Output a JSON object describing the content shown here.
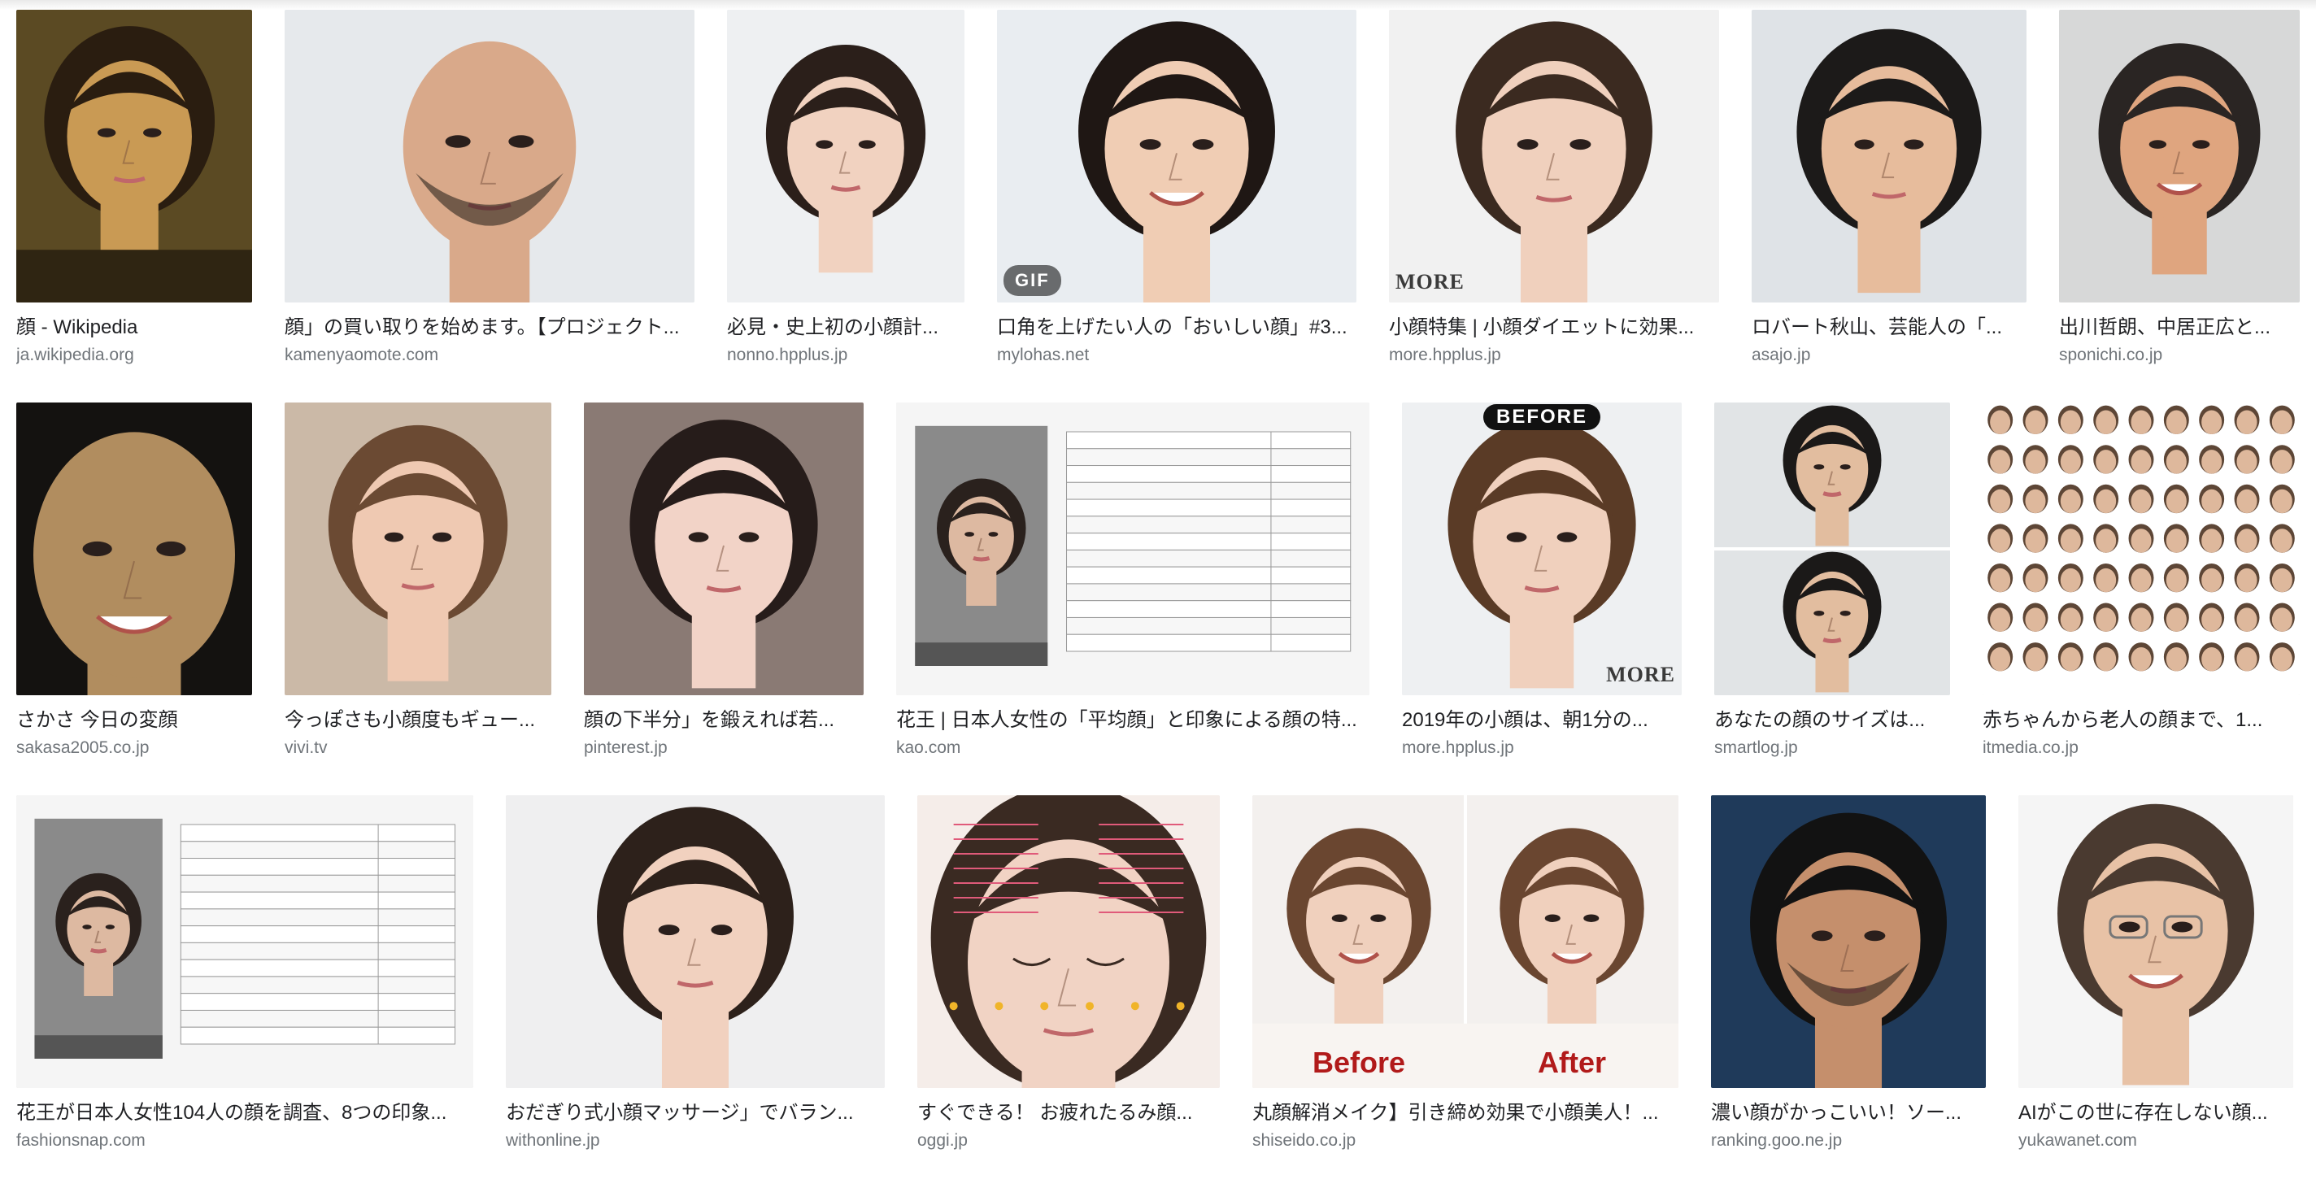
{
  "results": [
    [
      {
        "caption": "顔 - Wikipedia",
        "domain": "ja.wikipedia.org",
        "image": "mona-lisa-painting",
        "bg": "#5b4a23",
        "skin": "#c99a54",
        "hair": "#2a1d10"
      },
      {
        "caption": "顔」の買い取りを始めます。【プロジェクト...",
        "domain": "kamenyaomote.com",
        "image": "realistic-face-mask",
        "bg": "#e6e9ec",
        "skin": "#d9a98a",
        "hair": "#e6e9ec"
      },
      {
        "caption": "必見・史上初の小顔計...",
        "domain": "nonno.hpplus.jp",
        "image": "woman-portrait",
        "bg": "#eef0f2",
        "skin": "#f1d2c0",
        "hair": "#2b1f1a"
      },
      {
        "caption": "口角を上げたい人の「おいしい顔」#3...",
        "domain": "mylohas.net",
        "image": "smiling-woman-portrait",
        "bg": "#e9edf1",
        "skin": "#f0cdb4",
        "hair": "#1f1714",
        "badge": "GIF"
      },
      {
        "caption": "小顔特集 | 小顔ダイエットに効果...",
        "domain": "more.hpplus.jp",
        "image": "woman-bob-hair-portrait",
        "bg": "#f1f1f1",
        "skin": "#f0d0bd",
        "hair": "#3b2a20",
        "badge": "MORE"
      },
      {
        "caption": "ロバート秋山、芸能人の「...",
        "domain": "asajo.jp",
        "image": "man-portrait",
        "bg": "#dfe3e7",
        "skin": "#e7bc9c",
        "hair": "#1c1a19"
      },
      {
        "caption": "出川哲朗、中居正広と...",
        "domain": "sponichi.co.jp",
        "image": "man-portrait-laughing",
        "bg": "#d7d8d8",
        "skin": "#dfa57f",
        "hair": "#2a2523"
      }
    ],
    [
      {
        "caption": "さかさ 今日の変顔",
        "domain": "sakasa2005.co.jp",
        "image": "funny-face-dark",
        "bg": "#141210",
        "skin": "#b18d5f",
        "hair": "#141210"
      },
      {
        "caption": "今っぽさも小顔度もギュー...",
        "domain": "vivi.tv",
        "image": "woman-hand-on-chin",
        "bg": "#cbb9a7",
        "skin": "#efc9b2",
        "hair": "#6b4a33"
      },
      {
        "caption": "顔の下半分」を鍛えれば若...",
        "domain": "pinterest.jp",
        "image": "woman-closeup",
        "bg": "#8a7a74",
        "skin": "#f2d3c7",
        "hair": "#261c1a"
      },
      {
        "caption": "花王 | 日本人女性の「平均顔」と印象による顔の特...",
        "domain": "kao.com",
        "image": "average-face-chart",
        "bg": "#f5f5f5",
        "skin": "#ddb9a1",
        "hair": "#2a211d"
      },
      {
        "caption": "2019年の小顔は、朝1分の...",
        "domain": "more.hpplus.jp",
        "image": "woman-before-portrait",
        "bg": "#eef0f2",
        "skin": "#f0d0bd",
        "hair": "#5a3b26",
        "badge": "BEFORE",
        "watermark": "MORE"
      },
      {
        "caption": "あなたの顔のサイズは...",
        "domain": "smartlog.jp",
        "image": "man-portrait-two-photos",
        "bg": "#e1e4e6",
        "skin": "#e2bd9f",
        "hair": "#1b1918"
      },
      {
        "caption": "赤ちゃんから老人の顔まで、1...",
        "domain": "itmedia.co.jp",
        "image": "face-aging-grid",
        "bg": "#ffffff",
        "skin": "#deb89c",
        "hair": "#5d4636"
      }
    ],
    [
      {
        "caption": "花王が日本人女性104人の顔を調査、8つの印象...",
        "domain": "fashionsnap.com",
        "image": "average-face-chart",
        "bg": "#f5f5f5",
        "skin": "#ddb9a1",
        "hair": "#2a211d"
      },
      {
        "caption": "おだぎり式小顔マッサージ」でバラン...",
        "domain": "withonline.jp",
        "image": "woman-portrait-hand",
        "bg": "#efeff0",
        "skin": "#f1d1bf",
        "hair": "#2d211b"
      },
      {
        "caption": "すぐできる！ お疲れたるみ顔...",
        "domain": "oggi.jp",
        "image": "face-massage-diagram",
        "bg": "#f5ede9",
        "skin": "#f1d3c4",
        "hair": "#3a2a22"
      },
      {
        "caption": "丸顔解消メイク】引き締め効果で小顔美人！...",
        "domain": "shiseido.co.jp",
        "image": "before-after-makeup",
        "bg": "#f3f0ee",
        "skin": "#f0d0bd",
        "hair": "#6a4630",
        "before": "Before",
        "after": "After"
      },
      {
        "caption": "濃い顔がかっこいい！ソー...",
        "domain": "ranking.goo.ne.jp",
        "image": "man-with-beard",
        "bg": "#1f3a5a",
        "skin": "#c58f6c",
        "hair": "#121212"
      },
      {
        "caption": "AIがこの世に存在しない顔...",
        "domain": "yukawanet.com",
        "image": "man-with-glasses",
        "bg": "#f5f5f5",
        "skin": "#e8c2a6",
        "hair": "#4a3a30"
      }
    ]
  ]
}
